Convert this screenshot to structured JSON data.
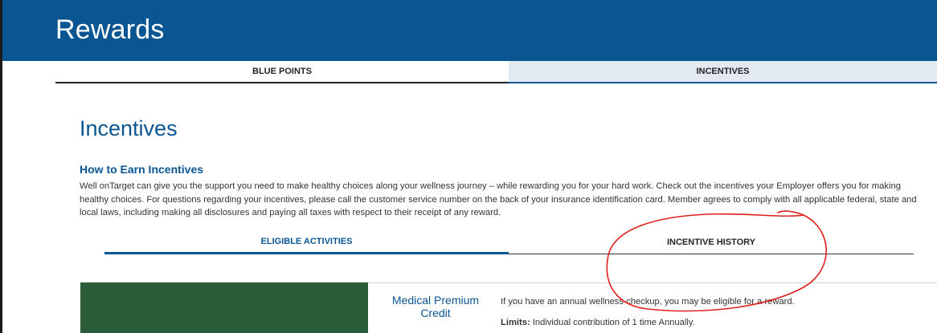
{
  "header": {
    "title": "Rewards"
  },
  "top_tabs": [
    {
      "label": "BLUE POINTS",
      "active": false
    },
    {
      "label": "INCENTIVES",
      "active": true
    }
  ],
  "page": {
    "title": "Incentives",
    "how_heading": "How to Earn Incentives",
    "intro": "Well onTarget can give you the support you need to make healthy choices along your wellness journey – while rewarding you for your hard work. Check out the incentives your Employer offers you for making healthy choices. For questions regarding your incentives, please call the customer service number on the back of your insurance identification card. Member agrees to comply with all applicable federal, state and local laws, including making all disclosures and paying all taxes with respect to their receipt of any reward."
  },
  "sub_tabs": [
    {
      "label": "ELIGIBLE ACTIVITIES",
      "active": true
    },
    {
      "label": "INCENTIVE HISTORY",
      "active": false
    }
  ],
  "incentive_card": {
    "title": "Medical Premium Credit",
    "description": "If you have an annual wellness checkup, you may be eligible for a reward.",
    "limits_label": "Limits:",
    "limits_text": "Individual contribution of 1 time Annually."
  },
  "colors": {
    "brand_blue": "#0a5693",
    "active_tab_bg": "#e2e9f0",
    "card_green": "#2a5c3a",
    "annotation_red": "#e0201c"
  }
}
